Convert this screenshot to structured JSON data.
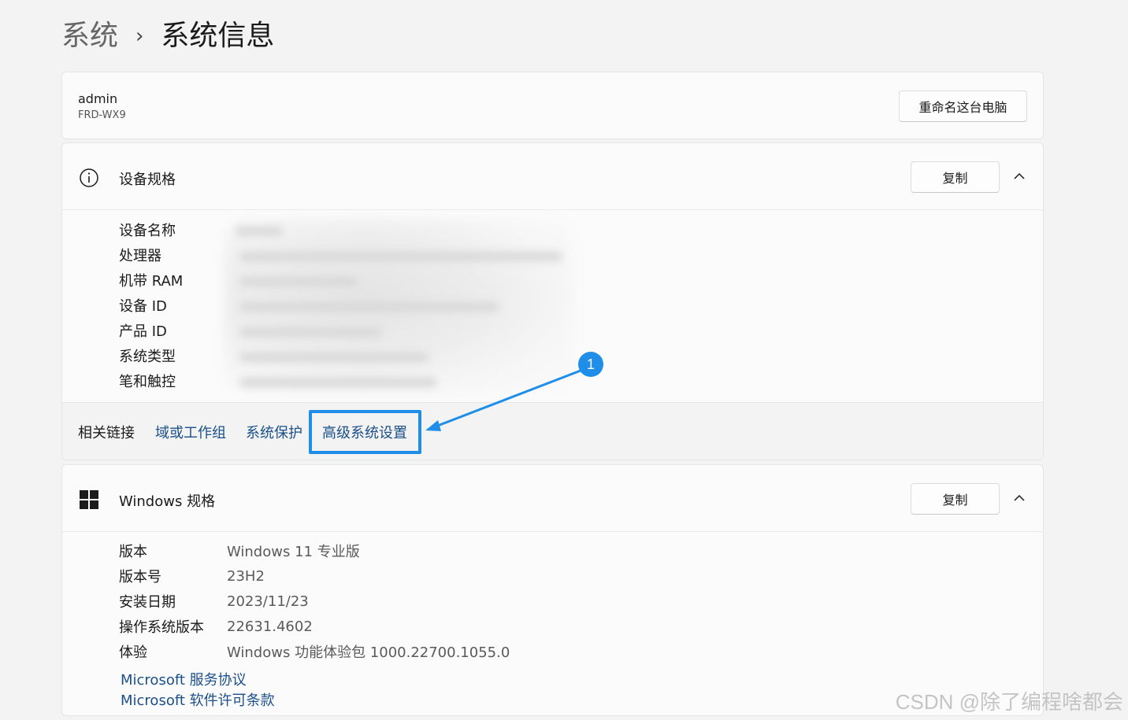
{
  "breadcrumb": {
    "parent": "系统",
    "separator": "›",
    "current": "系统信息"
  },
  "pc": {
    "name": "admin",
    "model": "FRD-WX9",
    "rename_label": "重命名这台电脑"
  },
  "device_specs": {
    "title": "设备规格",
    "copy_label": "复制",
    "icon": "info-icon",
    "rows": [
      {
        "label": "设备名称"
      },
      {
        "label": "处理器"
      },
      {
        "label": "机带 RAM"
      },
      {
        "label": "设备 ID"
      },
      {
        "label": "产品 ID"
      },
      {
        "label": "系统类型"
      },
      {
        "label": "笔和触控"
      }
    ]
  },
  "related_links": {
    "label": "相关链接",
    "links": [
      "域或工作组",
      "系统保护",
      "高级系统设置"
    ]
  },
  "annotation": {
    "badge": "1",
    "color": "#1e8ee8"
  },
  "windows_specs": {
    "title": "Windows 规格",
    "copy_label": "复制",
    "icon": "windows-logo-icon",
    "rows": [
      {
        "label": "版本",
        "value": "Windows 11 专业版"
      },
      {
        "label": "版本号",
        "value": "23H2"
      },
      {
        "label": "安装日期",
        "value": "2023/11/23"
      },
      {
        "label": "操作系统版本",
        "value": "22631.4602"
      },
      {
        "label": "体验",
        "value": "Windows 功能体验包 1000.22700.1055.0"
      }
    ],
    "links": [
      "Microsoft 服务协议",
      "Microsoft 软件许可条款"
    ]
  },
  "watermark": "CSDN @除了编程啥都会",
  "colors": {
    "link": "#1a4f8a",
    "accent": "#1e8ee8",
    "background": "#f3f3f3",
    "card": "#fbfbfb"
  }
}
